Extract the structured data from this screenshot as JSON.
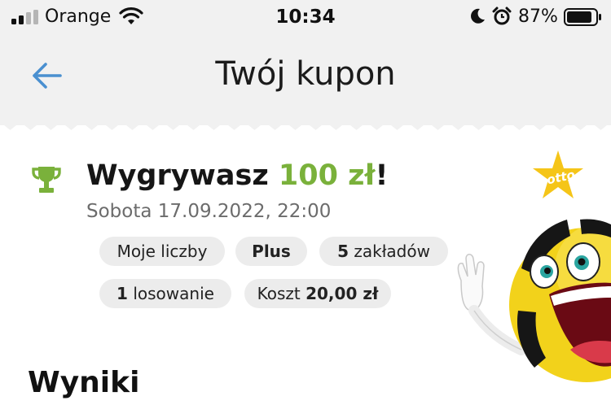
{
  "status_bar": {
    "carrier": "Orange",
    "time": "10:34",
    "battery_percent": "87%"
  },
  "nav": {
    "title": "Twój kupon"
  },
  "coupon": {
    "headline_prefix": "Wygrywasz ",
    "headline_amount": "100 zł",
    "headline_suffix": "!",
    "date": "Sobota 17.09.2022, 22:00",
    "chips": {
      "my_numbers": "Moje liczby",
      "plus": "Plus",
      "bets_count": "5",
      "bets_label": " zakładów",
      "draws_count": "1",
      "draws_label": " losowanie",
      "cost_label": "Koszt ",
      "cost_value": "20,00 zł"
    }
  },
  "results": {
    "heading": "Wyniki"
  },
  "mascot": {
    "badge_text": "Lotto"
  },
  "colors": {
    "accent_green": "#7ab13b",
    "back_arrow": "#4a90d0",
    "badge_yellow": "#f5c518"
  }
}
